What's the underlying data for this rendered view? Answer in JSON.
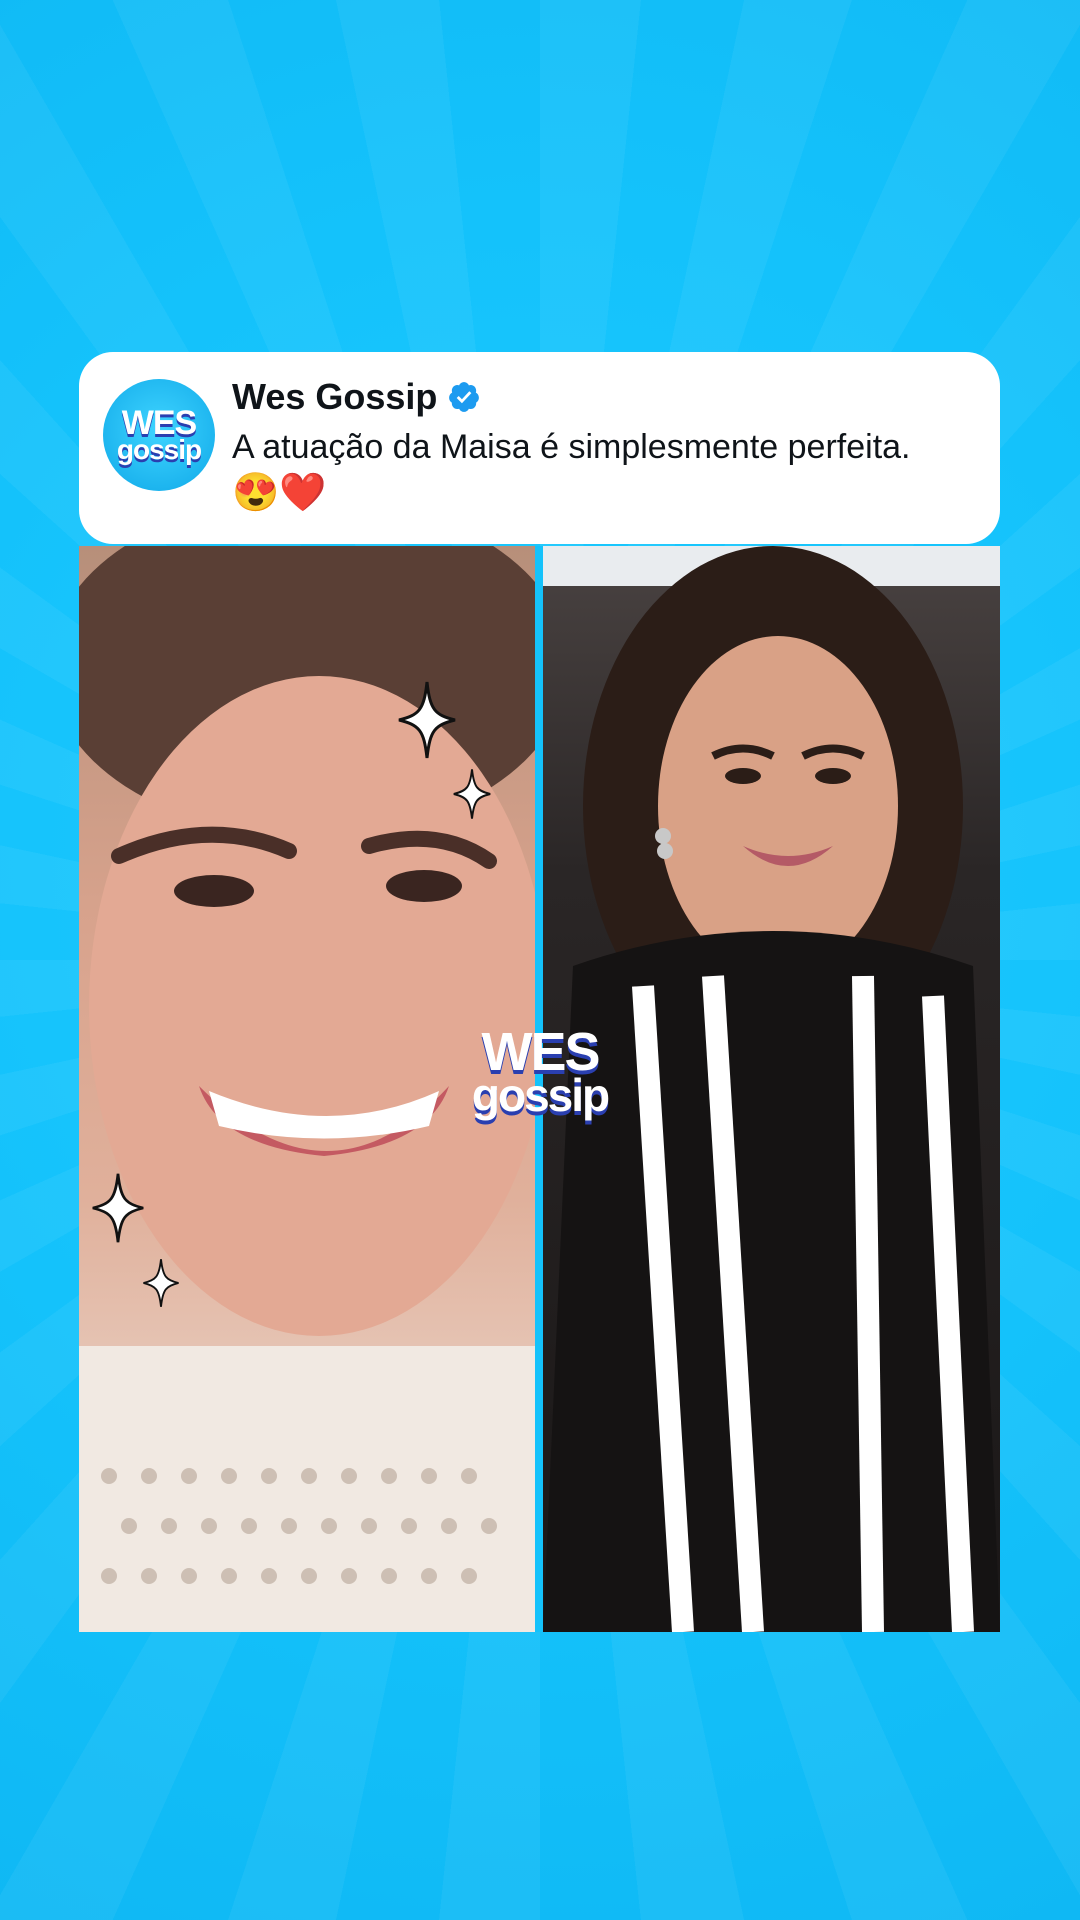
{
  "post": {
    "author": "Wes Gossip",
    "verified": true,
    "text": "A atuação da Maisa é simplesmente perfeita.",
    "emojis": "😍❤️",
    "avatar": {
      "line1": "WES",
      "line2": "gossip"
    }
  },
  "watermark": {
    "line1": "WES",
    "line2": "gossip"
  },
  "colors": {
    "background": "#14c2fb",
    "verified": "#1d9bf0"
  }
}
